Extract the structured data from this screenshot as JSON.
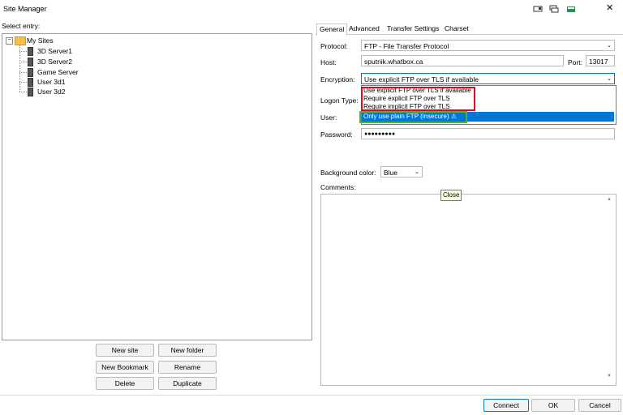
{
  "window": {
    "title": "Site Manager"
  },
  "left_panel": {
    "select_label": "Select entry:",
    "tree": {
      "root": "My Sites",
      "items": [
        "3D Server1",
        "3D Server2",
        "Game Server",
        "User 3d1",
        "User 3d2"
      ]
    },
    "buttons": {
      "new_site": "New site",
      "new_folder": "New folder",
      "new_bookmark": "New Bookmark",
      "rename": "Rename",
      "delete": "Delete",
      "duplicate": "Duplicate"
    }
  },
  "tabs": [
    "General",
    "Advanced",
    "Transfer Settings",
    "Charset"
  ],
  "general": {
    "protocol_label": "Protocol:",
    "protocol_value": "FTP - File Transfer Protocol",
    "host_label": "Host:",
    "host_value": "sputnik.whatbox.ca",
    "port_label": "Port:",
    "port_value": "13017",
    "encryption_label": "Encryption:",
    "encryption_value": "Use explicit FTP over TLS if available",
    "encryption_options": [
      "Use explicit FTP over TLS if available",
      "Require explicit FTP over TLS",
      "Require implicit FTP over TLS",
      "Only use plain FTP (insecure) ⚠"
    ],
    "logon_type_label": "Logon Type:",
    "user_label": "User:",
    "password_label": "Password:",
    "password_value": "●●●●●●●●●",
    "background_color_label": "Background color:",
    "background_color_value": "Blue",
    "comments_label": "Comments:",
    "tooltip": "Close"
  },
  "dialog_buttons": {
    "connect": "Connect",
    "ok": "OK",
    "cancel": "Cancel"
  },
  "colors": {
    "highlight": "#0078d7",
    "annotation_red": "#d0101d",
    "annotation_green": "#4cb04a",
    "folder": "#f2c14e"
  }
}
